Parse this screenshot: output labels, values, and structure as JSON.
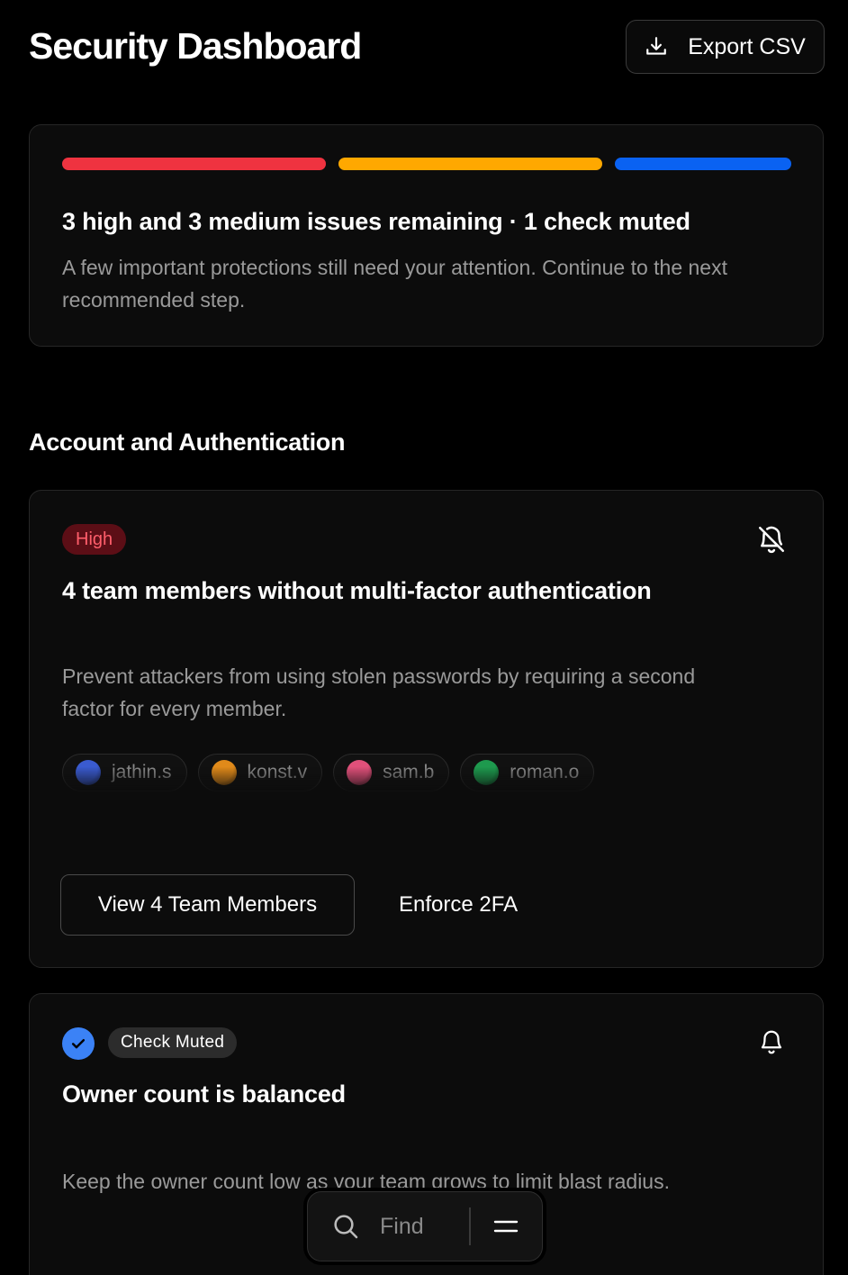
{
  "header": {
    "title": "Security Dashboard",
    "export_label": "Export CSV"
  },
  "colors": {
    "high": "#ef3340",
    "medium": "#ffa800",
    "info": "#0a62f2",
    "check": "#3b82f6"
  },
  "summary": {
    "title": "3 high and 3 medium issues remaining · 1 check muted",
    "description": "A few important protections still need your attention. Continue to the next recommended step."
  },
  "section": {
    "title": "Account and Authentication"
  },
  "cards": [
    {
      "severity": "High",
      "title": "4 team members without multi-factor authentication",
      "description": "Prevent attackers from using stolen passwords by requiring a second factor for every member.",
      "members": [
        {
          "name": "jathin.s",
          "color": "#3a5bd0"
        },
        {
          "name": "konst.v",
          "color": "#e08a1a"
        },
        {
          "name": "sam.b",
          "color": "#e0507a"
        },
        {
          "name": "roman.o",
          "color": "#1e9a4e"
        }
      ],
      "primary_action": "View 4 Team Members",
      "secondary_action": "Enforce 2FA",
      "icon": "bell-off-icon"
    },
    {
      "status": "Check Muted",
      "title": "Owner count is balanced",
      "description": "Keep the owner count low as your team grows to limit blast radius.",
      "icon": "bell-icon"
    }
  ],
  "findbar": {
    "placeholder": "Find"
  }
}
